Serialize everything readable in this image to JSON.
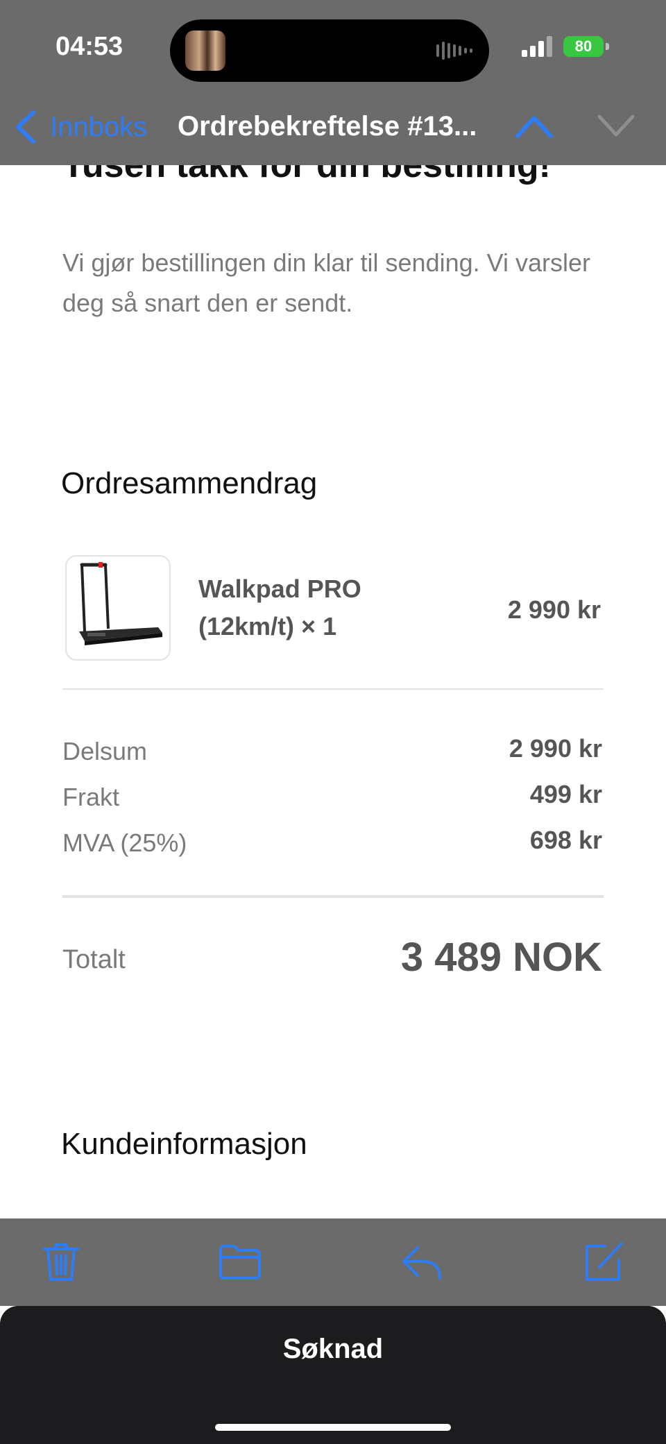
{
  "status_bar": {
    "time": "04:53",
    "battery": "80"
  },
  "nav": {
    "back_label": "Innboks",
    "title": "Ordrebekreftelse #13..."
  },
  "email": {
    "heading": "Tusen takk for din bestilling!",
    "intro": "Vi gjør bestillingen din klar til sending. Vi varsler deg så snart den er sendt.",
    "summary_title": "Ordresammendrag",
    "item": {
      "name": "Walkpad PRO (12km/t) × 1",
      "price": "2 990 kr"
    },
    "subtotal": {
      "label": "Delsum",
      "value": "2 990 kr"
    },
    "shipping": {
      "label": "Frakt",
      "value": "499 kr"
    },
    "vat": {
      "label": "MVA (25%)",
      "value": "698 kr"
    },
    "total": {
      "label": "Totalt",
      "value": "3 489 NOK"
    },
    "customer_title": "Kundeinformasjon"
  },
  "sheet": {
    "title": "Søknad"
  },
  "colors": {
    "accent": "#2f7df6",
    "bar": "#6b6b6b",
    "battery": "#39c640"
  }
}
